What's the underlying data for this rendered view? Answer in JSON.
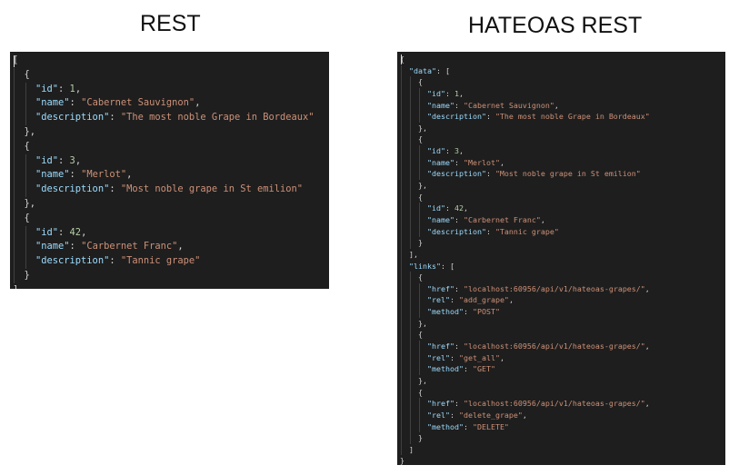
{
  "titles": {
    "rest": "REST",
    "hateoas": "HATEOAS REST"
  },
  "colors": {
    "background": "#1e1e1e",
    "key": "#9cdcfe",
    "string": "#ce9178",
    "number": "#b5cea8",
    "punct": "#d4d4d4"
  },
  "rest_json": [
    [
      0,
      [
        [
          "b",
          "["
        ]
      ]
    ],
    [
      1,
      [
        [
          "b",
          "{"
        ]
      ]
    ],
    [
      2,
      [
        [
          "k",
          "\"id\""
        ],
        [
          "p",
          ": "
        ],
        [
          "n",
          "1"
        ],
        [
          "p",
          ","
        ]
      ]
    ],
    [
      2,
      [
        [
          "k",
          "\"name\""
        ],
        [
          "p",
          ": "
        ],
        [
          "s",
          "\"Cabernet Sauvignon\""
        ],
        [
          "p",
          ","
        ]
      ]
    ],
    [
      2,
      [
        [
          "k",
          "\"description\""
        ],
        [
          "p",
          ": "
        ],
        [
          "s",
          "\"The most noble Grape in Bordeaux\""
        ]
      ]
    ],
    [
      1,
      [
        [
          "b",
          "},"
        ]
      ]
    ],
    [
      1,
      [
        [
          "b",
          "{"
        ]
      ]
    ],
    [
      2,
      [
        [
          "k",
          "\"id\""
        ],
        [
          "p",
          ": "
        ],
        [
          "n",
          "3"
        ],
        [
          "p",
          ","
        ]
      ]
    ],
    [
      2,
      [
        [
          "k",
          "\"name\""
        ],
        [
          "p",
          ": "
        ],
        [
          "s",
          "\"Merlot\""
        ],
        [
          "p",
          ","
        ]
      ]
    ],
    [
      2,
      [
        [
          "k",
          "\"description\""
        ],
        [
          "p",
          ": "
        ],
        [
          "s",
          "\"Most noble grape in St emilion\""
        ]
      ]
    ],
    [
      1,
      [
        [
          "b",
          "},"
        ]
      ]
    ],
    [
      1,
      [
        [
          "b",
          "{"
        ]
      ]
    ],
    [
      2,
      [
        [
          "k",
          "\"id\""
        ],
        [
          "p",
          ": "
        ],
        [
          "n",
          "42"
        ],
        [
          "p",
          ","
        ]
      ]
    ],
    [
      2,
      [
        [
          "k",
          "\"name\""
        ],
        [
          "p",
          ": "
        ],
        [
          "s",
          "\"Carbernet Franc\""
        ],
        [
          "p",
          ","
        ]
      ]
    ],
    [
      2,
      [
        [
          "k",
          "\"description\""
        ],
        [
          "p",
          ": "
        ],
        [
          "s",
          "\"Tannic grape\""
        ]
      ]
    ],
    [
      1,
      [
        [
          "b",
          "}"
        ]
      ]
    ],
    [
      0,
      [
        [
          "b",
          "]"
        ]
      ]
    ]
  ],
  "hateoas_json": [
    [
      0,
      [
        [
          "b",
          "{"
        ]
      ]
    ],
    [
      1,
      [
        [
          "k",
          "\"data\""
        ],
        [
          "p",
          ": "
        ],
        [
          "b",
          "["
        ]
      ]
    ],
    [
      2,
      [
        [
          "b",
          "{"
        ]
      ]
    ],
    [
      3,
      [
        [
          "k",
          "\"id\""
        ],
        [
          "p",
          ": "
        ],
        [
          "n",
          "1"
        ],
        [
          "p",
          ","
        ]
      ]
    ],
    [
      3,
      [
        [
          "k",
          "\"name\""
        ],
        [
          "p",
          ": "
        ],
        [
          "s",
          "\"Cabernet Sauvignon\""
        ],
        [
          "p",
          ","
        ]
      ]
    ],
    [
      3,
      [
        [
          "k",
          "\"description\""
        ],
        [
          "p",
          ": "
        ],
        [
          "s",
          "\"The most noble Grape in Bordeaux\""
        ]
      ]
    ],
    [
      2,
      [
        [
          "b",
          "},"
        ]
      ]
    ],
    [
      2,
      [
        [
          "b",
          "{"
        ]
      ]
    ],
    [
      3,
      [
        [
          "k",
          "\"id\""
        ],
        [
          "p",
          ": "
        ],
        [
          "n",
          "3"
        ],
        [
          "p",
          ","
        ]
      ]
    ],
    [
      3,
      [
        [
          "k",
          "\"name\""
        ],
        [
          "p",
          ": "
        ],
        [
          "s",
          "\"Merlot\""
        ],
        [
          "p",
          ","
        ]
      ]
    ],
    [
      3,
      [
        [
          "k",
          "\"description\""
        ],
        [
          "p",
          ": "
        ],
        [
          "s",
          "\"Most noble grape in St emilion\""
        ]
      ]
    ],
    [
      2,
      [
        [
          "b",
          "},"
        ]
      ]
    ],
    [
      2,
      [
        [
          "b",
          "{"
        ]
      ]
    ],
    [
      3,
      [
        [
          "k",
          "\"id\""
        ],
        [
          "p",
          ": "
        ],
        [
          "n",
          "42"
        ],
        [
          "p",
          ","
        ]
      ]
    ],
    [
      3,
      [
        [
          "k",
          "\"name\""
        ],
        [
          "p",
          ": "
        ],
        [
          "s",
          "\"Carbernet Franc\""
        ],
        [
          "p",
          ","
        ]
      ]
    ],
    [
      3,
      [
        [
          "k",
          "\"description\""
        ],
        [
          "p",
          ": "
        ],
        [
          "s",
          "\"Tannic grape\""
        ]
      ]
    ],
    [
      2,
      [
        [
          "b",
          "}"
        ]
      ]
    ],
    [
      1,
      [
        [
          "b",
          "],"
        ]
      ]
    ],
    [
      1,
      [
        [
          "k",
          "\"links\""
        ],
        [
          "p",
          ": "
        ],
        [
          "b",
          "["
        ]
      ]
    ],
    [
      2,
      [
        [
          "b",
          "{"
        ]
      ]
    ],
    [
      3,
      [
        [
          "k",
          "\"href\""
        ],
        [
          "p",
          ": "
        ],
        [
          "s",
          "\"localhost:60956/api/v1/hateoas-grapes/\""
        ],
        [
          "p",
          ","
        ]
      ]
    ],
    [
      3,
      [
        [
          "k",
          "\"rel\""
        ],
        [
          "p",
          ": "
        ],
        [
          "s",
          "\"add_grape\""
        ],
        [
          "p",
          ","
        ]
      ]
    ],
    [
      3,
      [
        [
          "k",
          "\"method\""
        ],
        [
          "p",
          ": "
        ],
        [
          "s",
          "\"POST\""
        ]
      ]
    ],
    [
      2,
      [
        [
          "b",
          "},"
        ]
      ]
    ],
    [
      2,
      [
        [
          "b",
          "{"
        ]
      ]
    ],
    [
      3,
      [
        [
          "k",
          "\"href\""
        ],
        [
          "p",
          ": "
        ],
        [
          "s",
          "\"localhost:60956/api/v1/hateoas-grapes/\""
        ],
        [
          "p",
          ","
        ]
      ]
    ],
    [
      3,
      [
        [
          "k",
          "\"rel\""
        ],
        [
          "p",
          ": "
        ],
        [
          "s",
          "\"get_all\""
        ],
        [
          "p",
          ","
        ]
      ]
    ],
    [
      3,
      [
        [
          "k",
          "\"method\""
        ],
        [
          "p",
          ": "
        ],
        [
          "s",
          "\"GET\""
        ]
      ]
    ],
    [
      2,
      [
        [
          "b",
          "},"
        ]
      ]
    ],
    [
      2,
      [
        [
          "b",
          "{"
        ]
      ]
    ],
    [
      3,
      [
        [
          "k",
          "\"href\""
        ],
        [
          "p",
          ": "
        ],
        [
          "s",
          "\"localhost:60956/api/v1/hateoas-grapes/\""
        ],
        [
          "p",
          ","
        ]
      ]
    ],
    [
      3,
      [
        [
          "k",
          "\"rel\""
        ],
        [
          "p",
          ": "
        ],
        [
          "s",
          "\"delete_grape\""
        ],
        [
          "p",
          ","
        ]
      ]
    ],
    [
      3,
      [
        [
          "k",
          "\"method\""
        ],
        [
          "p",
          ": "
        ],
        [
          "s",
          "\"DELETE\""
        ]
      ]
    ],
    [
      2,
      [
        [
          "b",
          "}"
        ]
      ]
    ],
    [
      1,
      [
        [
          "b",
          "]"
        ]
      ]
    ],
    [
      0,
      [
        [
          "b",
          "}"
        ]
      ]
    ]
  ]
}
